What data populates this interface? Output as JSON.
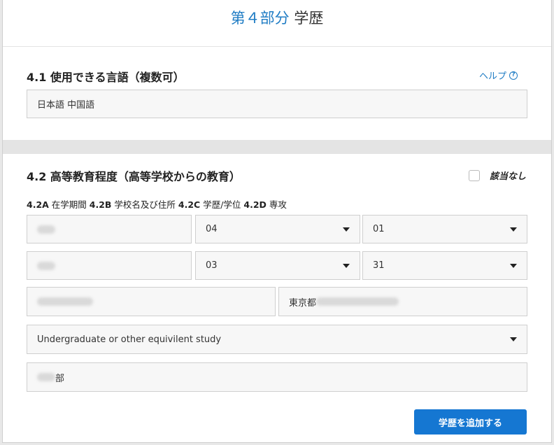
{
  "header": {
    "title_accent": "第４部分",
    "title_text": "学歴"
  },
  "section1": {
    "heading": "4.1 使用できる言語（複数可）",
    "help_label": "ヘルプ",
    "help_icon": "?",
    "languages_value": "日本語 中国語"
  },
  "section2": {
    "heading": "4.2 高等教育程度（高等学校からの教育）",
    "not_applicable_label": "該当なし",
    "subheader": {
      "a_code": "4.2A",
      "a_text": " 在学期間 ",
      "b_code": "4.2B",
      "b_text": " 学校名及び住所 ",
      "c_code": "4.2C",
      "c_text": " 学歴/学位 ",
      "d_code": "4.2D",
      "d_text": " 専攻"
    },
    "start_month": "04",
    "start_day": "01",
    "end_month": "03",
    "end_day": "31",
    "address_prefix": "東京都",
    "degree": "Undergraduate or other equivilent study",
    "major_suffix": "部",
    "add_button": "学歴を追加する"
  },
  "colors": {
    "accent": "#1f7cc4",
    "button": "#1577d2"
  }
}
